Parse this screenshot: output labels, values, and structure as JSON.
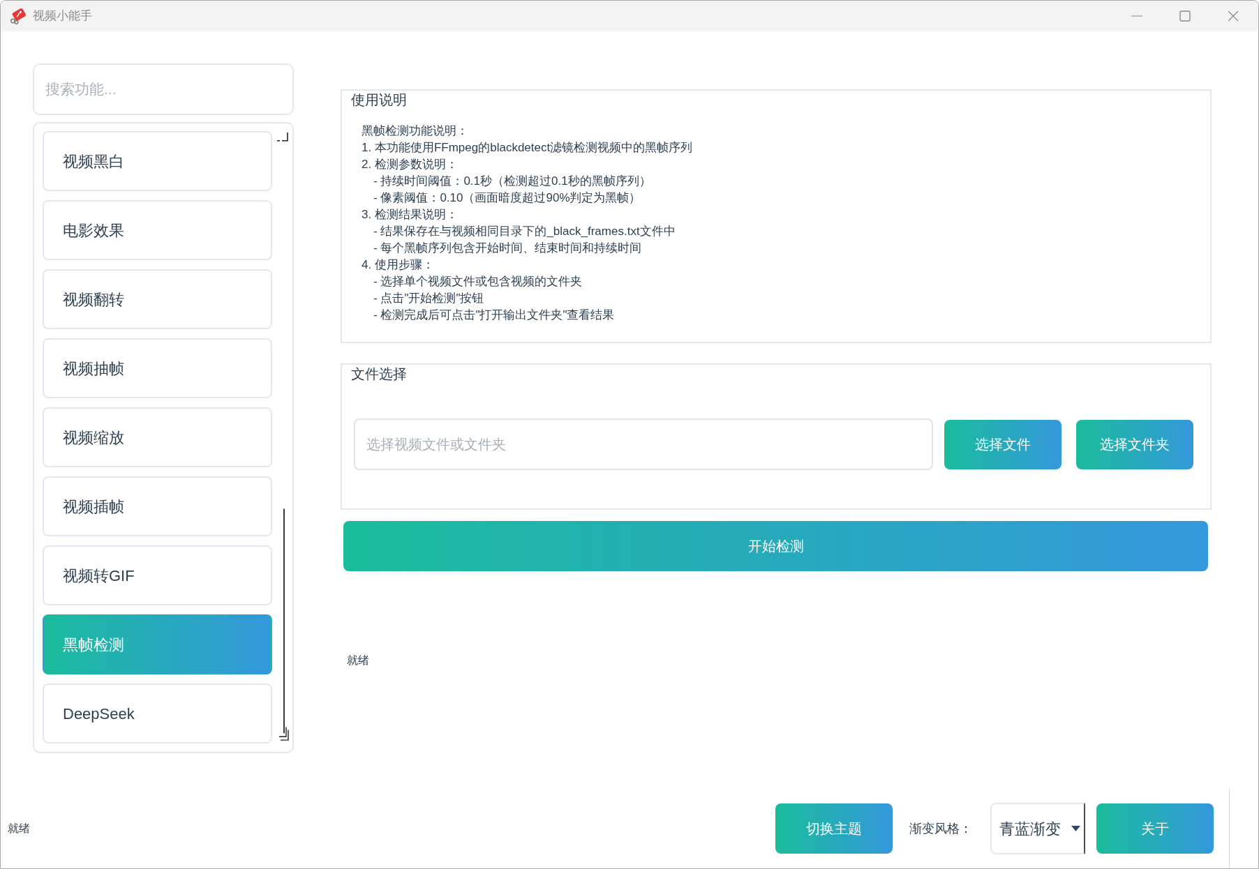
{
  "window": {
    "title": "视频小能手"
  },
  "sidebar": {
    "search": {
      "placeholder": "搜索功能..."
    },
    "items": [
      {
        "label": "视频黑白",
        "selected": false
      },
      {
        "label": "电影效果",
        "selected": false
      },
      {
        "label": "视频翻转",
        "selected": false
      },
      {
        "label": "视频抽帧",
        "selected": false
      },
      {
        "label": "视频缩放",
        "selected": false
      },
      {
        "label": "视频插帧",
        "selected": false
      },
      {
        "label": "视频转GIF",
        "selected": false
      },
      {
        "label": "黑帧检测",
        "selected": true
      },
      {
        "label": "DeepSeek",
        "selected": false
      }
    ]
  },
  "usage": {
    "title": "使用说明",
    "heading": "黑帧检测功能说明：",
    "sections": [
      {
        "text": "1. 本功能使用FFmpeg的blackdetect滤镜检测视频中的黑帧序列"
      },
      {
        "text": "2. 检测参数说明：",
        "children": [
          "- 持续时间阈值：0.1秒（检测超过0.1秒的黑帧序列）",
          "- 像素阈值：0.10（画面暗度超过90%判定为黑帧）"
        ]
      },
      {
        "text": "3. 检测结果说明：",
        "children": [
          "- 结果保存在与视频相同目录下的_black_frames.txt文件中",
          "- 每个黑帧序列包含开始时间、结束时间和持续时间"
        ]
      },
      {
        "text": "4. 使用步骤：",
        "children": [
          "- 选择单个视频文件或包含视频的文件夹",
          "- 点击\"开始检测\"按钮",
          "- 检测完成后可点击\"打开输出文件夹\"查看结果"
        ]
      }
    ]
  },
  "file_select": {
    "title": "文件选择",
    "path_field": {
      "placeholder": "选择视频文件或文件夹"
    },
    "buttons": [
      "选择文件",
      "选择文件夹"
    ]
  },
  "start_button": "开始检测",
  "status": "就绪",
  "status_bar": {
    "text": "就绪",
    "theme_button": "切换主题",
    "gradient_label": "渐变风格：",
    "gradient_select": {
      "value": "青蓝渐变"
    },
    "about_button": "关于"
  }
}
